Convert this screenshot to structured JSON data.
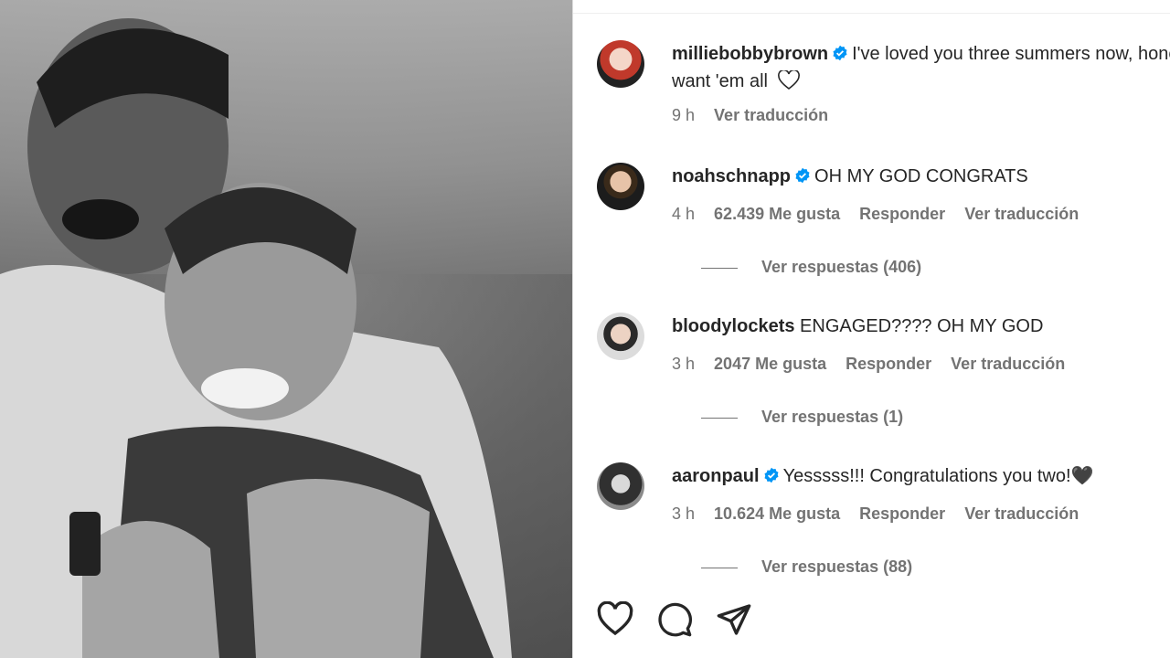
{
  "post": {
    "author": "milliebobbybrown",
    "caption_line1": "I've loved you three summers now, honey but I",
    "caption_line2": "want 'em all",
    "caption_time": "9 h",
    "caption_translate": "Ver traducción"
  },
  "comments": [
    {
      "user": "noahschnapp",
      "verified": true,
      "text": "OH MY GOD CONGRATS",
      "time": "4 h",
      "likes": "62.439 Me gusta",
      "reply": "Responder",
      "translate": "Ver traducción",
      "view_replies": "Ver respuestas (406)"
    },
    {
      "user": "bloodylockets",
      "verified": false,
      "text": "ENGAGED???? OH MY GOD",
      "time": "3 h",
      "likes": "2047 Me gusta",
      "reply": "Responder",
      "translate": "Ver traducción",
      "view_replies": "Ver respuestas (1)"
    },
    {
      "user": "aaronpaul",
      "verified": true,
      "text": "Yesssss!!! Congratulations you two!🖤",
      "time": "3 h",
      "likes": "10.624 Me gusta",
      "reply": "Responder",
      "translate": "Ver traducción",
      "view_replies": "Ver respuestas (88)"
    }
  ],
  "icons": {
    "like": "heart-icon",
    "comment": "comment-icon",
    "share": "paper-plane-icon",
    "verified": "verified-badge-icon"
  },
  "colors": {
    "verified": "#0095f6",
    "text": "#262626",
    "muted": "#737373",
    "divider": "#dbdbdb"
  }
}
